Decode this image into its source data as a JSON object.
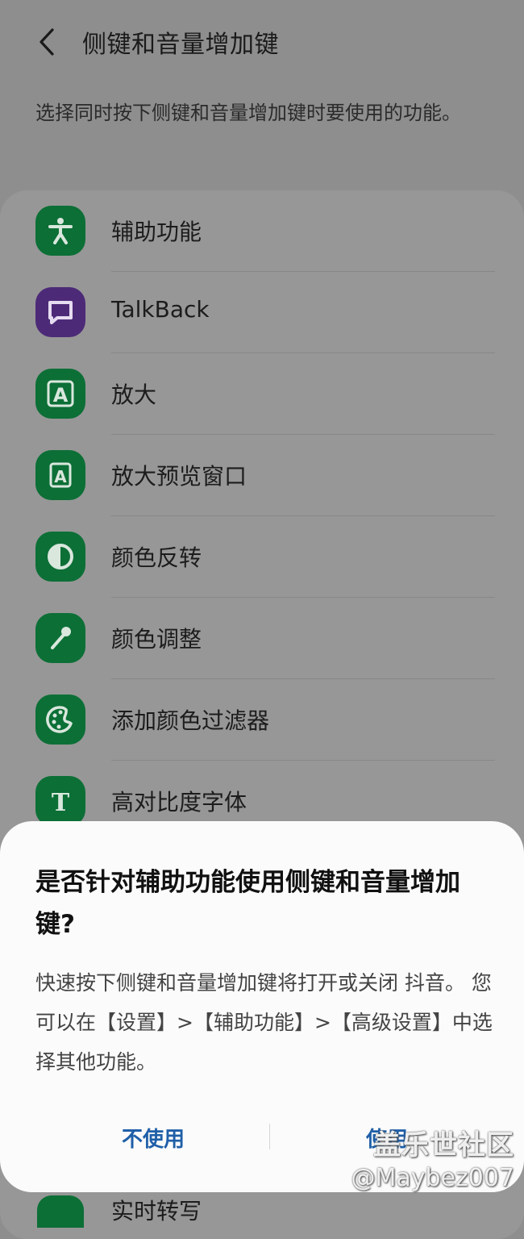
{
  "header": {
    "title": "侧键和音量增加键",
    "description": "选择同时按下侧键和音量增加键时要使用的功能。"
  },
  "list": {
    "items": [
      {
        "label": "辅助功能",
        "icon": "accessibility-icon"
      },
      {
        "label": "TalkBack",
        "icon": "talkback-icon"
      },
      {
        "label": "放大",
        "icon": "magnify-icon"
      },
      {
        "label": "放大预览窗口",
        "icon": "magnifier-window-icon"
      },
      {
        "label": "颜色反转",
        "icon": "invert-colors-icon"
      },
      {
        "label": "颜色调整",
        "icon": "color-adjust-icon"
      },
      {
        "label": "添加颜色过滤器",
        "icon": "color-filter-icon"
      },
      {
        "label": "高对比度字体",
        "icon": "high-contrast-font-icon"
      }
    ],
    "partial_item": {
      "label": "实时转写",
      "icon": "live-transcribe-icon"
    }
  },
  "dialog": {
    "title": "是否针对辅助功能使用侧键和音量增加键?",
    "body": "快速按下侧键和音量增加键将打开或关闭 抖音。 您可以在【设置】>【辅助功能】>【高级设置】中选择其他功能。",
    "cancel_label": "不使用",
    "confirm_label": "使用"
  },
  "watermark": {
    "line1": "盖乐世社区",
    "line2": "@Maybez007"
  },
  "colors": {
    "icon_green": "#0c6f36",
    "icon_purple": "#4d2a78",
    "button_text": "#1f5fa8",
    "dim_background": "#8e8e8e"
  }
}
